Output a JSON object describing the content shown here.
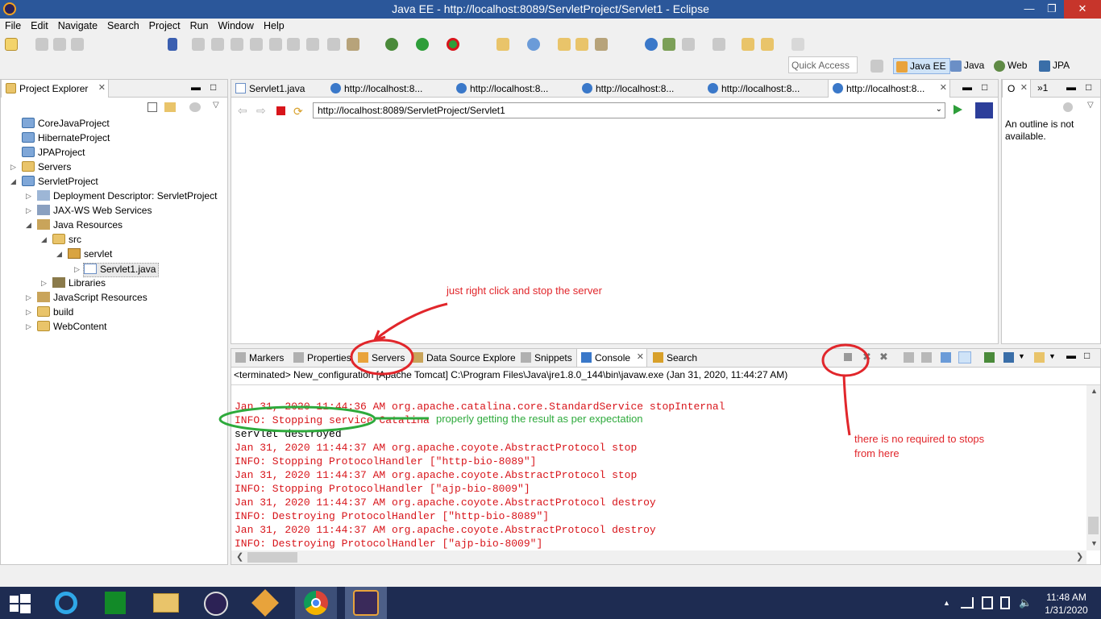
{
  "window": {
    "title": "Java EE - http://localhost:8089/ServletProject/Servlet1 - Eclipse"
  },
  "menu": [
    "File",
    "Edit",
    "Navigate",
    "Search",
    "Project",
    "Run",
    "Window",
    "Help"
  ],
  "quick_access": "Quick Access",
  "perspectives": [
    "Java EE",
    "Java",
    "Web",
    "JPA"
  ],
  "project_explorer": {
    "title": "Project Explorer",
    "items": [
      {
        "label": "CoreJavaProject"
      },
      {
        "label": "HibernateProject"
      },
      {
        "label": "JPAProject"
      },
      {
        "label": "Servers"
      },
      {
        "label": "ServletProject"
      },
      {
        "label": "Deployment Descriptor: ServletProject"
      },
      {
        "label": "JAX-WS Web Services"
      },
      {
        "label": "Java Resources"
      },
      {
        "label": "src"
      },
      {
        "label": "servlet"
      },
      {
        "label": "Servlet1.java"
      },
      {
        "label": "Libraries"
      },
      {
        "label": "JavaScript Resources"
      },
      {
        "label": "build"
      },
      {
        "label": "WebContent"
      }
    ]
  },
  "editor_tabs": [
    "Servlet1.java",
    "http://localhost:8...",
    "http://localhost:8...",
    "http://localhost:8...",
    "http://localhost:8...",
    "http://localhost:8..."
  ],
  "browser": {
    "url": "http://localhost:8089/ServletProject/Servlet1"
  },
  "outline": {
    "tab": "O",
    "tab2": "»1",
    "message": "An outline is not available."
  },
  "bottom_tabs": [
    "Markers",
    "Properties",
    "Servers",
    "Data Source Explorer",
    "Snippets",
    "Console",
    "Search"
  ],
  "console": {
    "header": "<terminated> New_configuration [Apache Tomcat] C:\\Program Files\\Java\\jre1.8.0_144\\bin\\javaw.exe (Jan 31, 2020, 11:44:27 AM)",
    "lines": [
      {
        "text": "Jan 31, 2020 11:44:36 AM org.apache.catalina.core.StandardService stopInternal",
        "color": "#d8151b"
      },
      {
        "text": "INFO: Stopping service Catalina",
        "color": "#d8151b"
      },
      {
        "text": "servlet destroyed",
        "color": "#000000"
      },
      {
        "text": "Jan 31, 2020 11:44:37 AM org.apache.coyote.AbstractProtocol stop",
        "color": "#d8151b"
      },
      {
        "text": "INFO: Stopping ProtocolHandler [\"http-bio-8089\"]",
        "color": "#d8151b"
      },
      {
        "text": "Jan 31, 2020 11:44:37 AM org.apache.coyote.AbstractProtocol stop",
        "color": "#d8151b"
      },
      {
        "text": "INFO: Stopping ProtocolHandler [\"ajp-bio-8009\"]",
        "color": "#d8151b"
      },
      {
        "text": "Jan 31, 2020 11:44:37 AM org.apache.coyote.AbstractProtocol destroy",
        "color": "#d8151b"
      },
      {
        "text": "INFO: Destroying ProtocolHandler [\"http-bio-8089\"]",
        "color": "#d8151b"
      },
      {
        "text": "Jan 31, 2020 11:44:37 AM org.apache.coyote.AbstractProtocol destroy",
        "color": "#d8151b"
      },
      {
        "text": "INFO: Destroying ProtocolHandler [\"ajp-bio-8009\"]",
        "color": "#d8151b"
      }
    ]
  },
  "annotations": {
    "stop_server": "just right click and stop the server",
    "result": "properly getting the result as per expectation",
    "no_stop_1": "there is no required to stops",
    "no_stop_2": "from here"
  },
  "clock": {
    "time": "11:48 AM",
    "date": "1/31/2020"
  },
  "colors": {
    "titlebar": "#2b579a",
    "taskbar": "#1e2c52",
    "annotation_red": "#e1262b",
    "annotation_green": "#2eaa3c"
  }
}
